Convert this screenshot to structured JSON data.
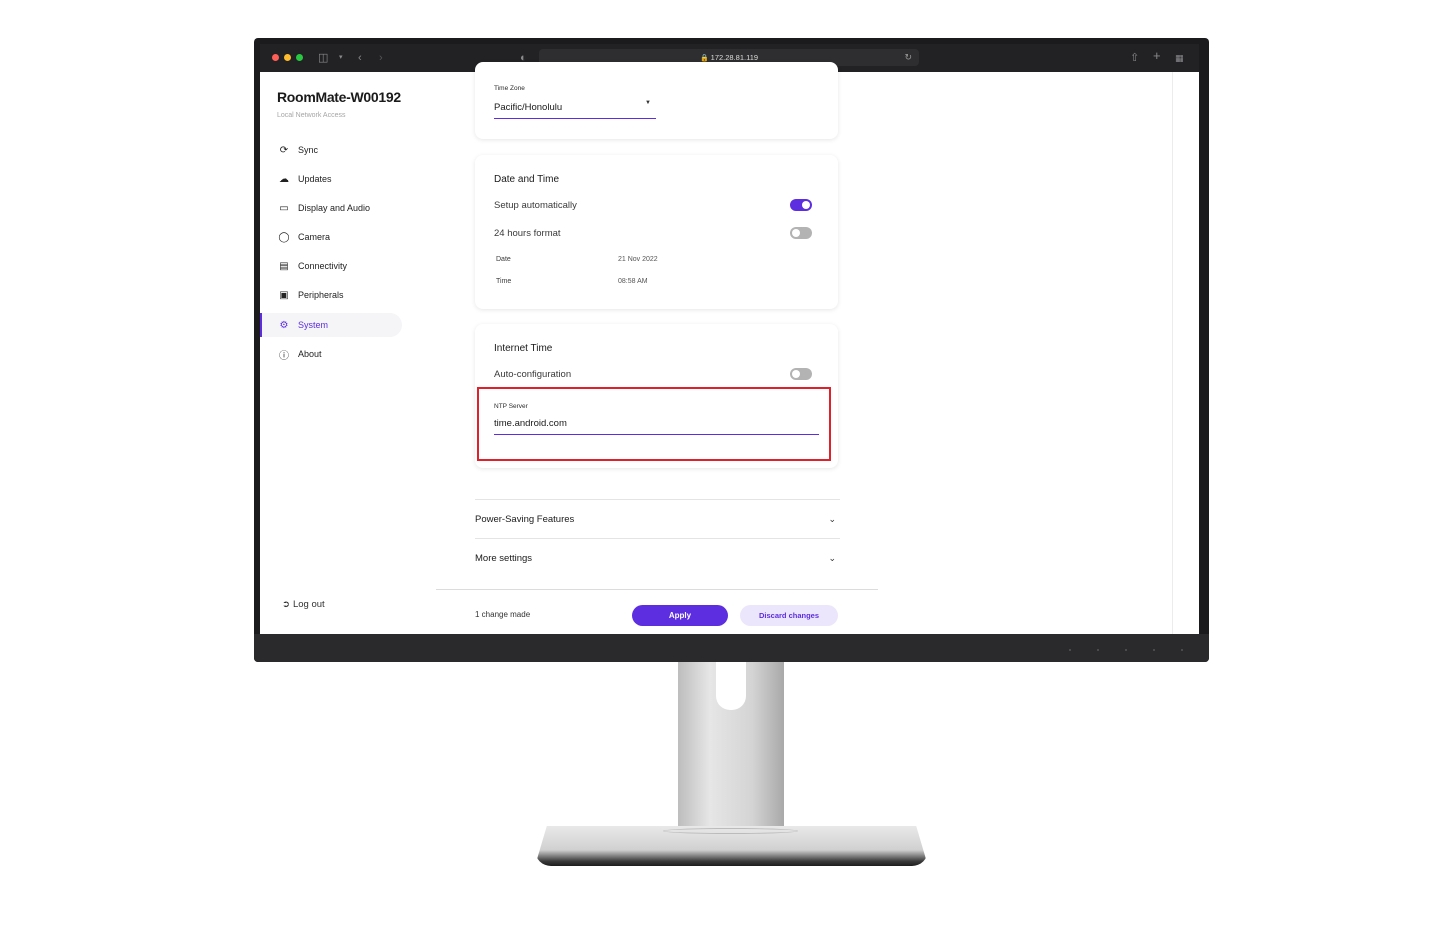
{
  "browser": {
    "url": "172.28.81.119",
    "traffic_lights": [
      "#ff5f57",
      "#febc2e",
      "#28c840"
    ],
    "icons": [
      "sidebar-toggle-icon",
      "chevron-down-icon",
      "back-icon",
      "forward-icon",
      "shield-icon",
      "lock-icon",
      "reload-icon",
      "share-icon",
      "new-tab-icon",
      "tab-overview-icon"
    ]
  },
  "app": {
    "title": "RoomMate-W00192",
    "subtitle": "Local Network Access",
    "accent_color": "#5c2ee0"
  },
  "sidebar": {
    "items": [
      {
        "label": "Sync",
        "icon": "sync-icon"
      },
      {
        "label": "Updates",
        "icon": "cloud-download-icon"
      },
      {
        "label": "Display and Audio",
        "icon": "monitor-icon"
      },
      {
        "label": "Camera",
        "icon": "camera-icon"
      },
      {
        "label": "Connectivity",
        "icon": "network-icon"
      },
      {
        "label": "Peripherals",
        "icon": "peripherals-icon"
      },
      {
        "label": "System",
        "icon": "gear-icon",
        "active": true
      },
      {
        "label": "About",
        "icon": "info-icon"
      }
    ],
    "logout_label": "Log out"
  },
  "timezone_card": {
    "label": "Time Zone",
    "value": "Pacific/Honolulu"
  },
  "datetime_card": {
    "title": "Date and Time",
    "setup_auto_label": "Setup automatically",
    "setup_auto_on": true,
    "format_24h_label": "24 hours format",
    "format_24h_on": false,
    "date_label": "Date",
    "date_value": "21 Nov 2022",
    "time_label": "Time",
    "time_value": "08:58 AM"
  },
  "internet_time_card": {
    "title": "Internet Time",
    "auto_config_label": "Auto-configuration",
    "auto_config_on": false,
    "ntp_label": "NTP Server",
    "ntp_value": "time.android.com"
  },
  "accordions": [
    {
      "label": "Power-Saving Features"
    },
    {
      "label": "More settings"
    }
  ],
  "footer": {
    "change_text": "1 change made",
    "apply_label": "Apply",
    "discard_label": "Discard changes"
  }
}
